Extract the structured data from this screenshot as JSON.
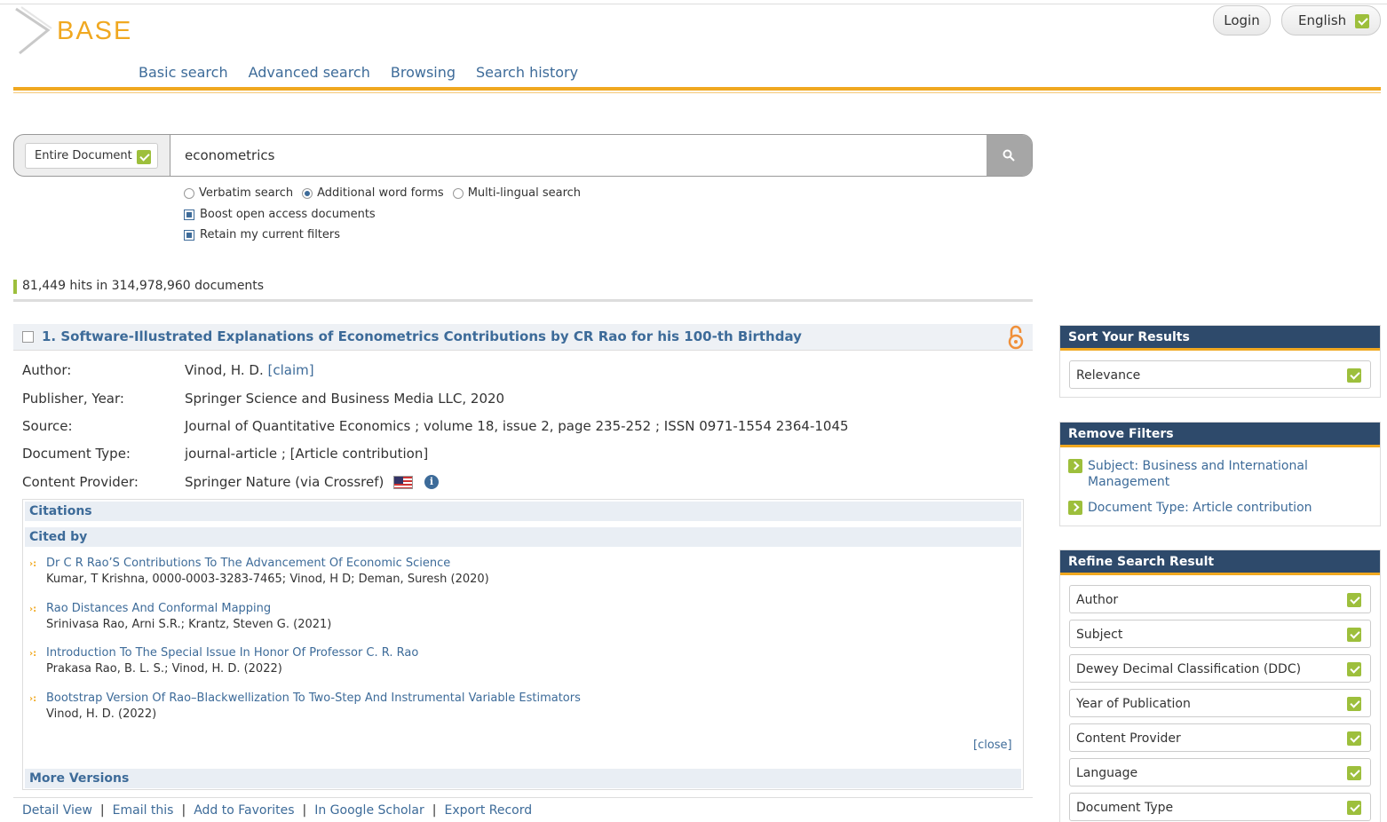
{
  "brand": {
    "logo_text": "BASE"
  },
  "header": {
    "login_label": "Login",
    "language_label": "English"
  },
  "nav": {
    "items": [
      "Basic search",
      "Advanced search",
      "Browsing",
      "Search history"
    ]
  },
  "search": {
    "scope": "Entire Document",
    "query": "econometrics",
    "options": {
      "verbatim": "Verbatim search",
      "additional": "Additional word forms",
      "multilingual": "Multi-lingual search",
      "selected": "Additional word forms"
    },
    "boost_open_access": {
      "label": "Boost open access documents",
      "checked": true
    },
    "retain_filters": {
      "label": "Retain my current filters",
      "checked": true
    }
  },
  "results_summary": "81,449 hits in 314,978,960 documents",
  "result": {
    "title": "1. Software-Illustrated Explanations of Econometrics Contributions by CR Rao for his 100-th Birthday",
    "author_label": "Author:",
    "author": "Vinod, H. D.",
    "claim": "[claim]",
    "publisher_label": "Publisher, Year:",
    "publisher": "Springer Science and Business Media LLC, 2020",
    "source_label": "Source:",
    "source": "Journal of Quantitative Economics ; volume 18, issue 2, page 235-252 ; ISSN 0971-1554 2364-1045",
    "doctype_label": "Document Type:",
    "doctype": "journal-article ; [Article contribution]",
    "provider_label": "Content Provider:",
    "provider": "Springer Nature (via Crossref)",
    "citations_label": "Citations",
    "cited_by_label": "Cited by",
    "cited_by": [
      {
        "title": "Dr C R Rao’S Contributions To The Advancement Of Economic Science",
        "authors": "Kumar, T Krishna, 0000-0003-3283-7465; Vinod, H D; Deman, Suresh (2020)"
      },
      {
        "title": "Rao Distances And Conformal Mapping",
        "authors": "Srinivasa Rao, Arni S.R.; Krantz, Steven G. (2021)"
      },
      {
        "title": "Introduction To The Special Issue In Honor Of Professor C. R. Rao",
        "authors": "Prakasa Rao, B. L. S.; Vinod, H. D. (2022)"
      },
      {
        "title": "Bootstrap Version Of Rao–Blackwellization To Two-Step And Instrumental Variable Estimators",
        "authors": "Vinod, H. D. (2022)"
      }
    ],
    "close_label": "[close]",
    "more_versions_label": "More Versions",
    "actions": [
      "Detail View",
      "Email this",
      "Add to Favorites",
      "In Google Scholar",
      "Export Record"
    ]
  },
  "sidebar": {
    "sort_title": "Sort Your Results",
    "sort_value": "Relevance",
    "remove_title": "Remove Filters",
    "filters": [
      "Subject: Business and International Management",
      "Document Type: Article contribution"
    ],
    "refine_title": "Refine Search Result",
    "refine": [
      "Author",
      "Subject",
      "Dewey Decimal Classification (DDC)",
      "Year of Publication",
      "Content Provider",
      "Language",
      "Document Type"
    ]
  },
  "colors": {
    "accent": "#f0a820",
    "link": "#3d6b99",
    "panel_header": "#2e4a6b",
    "check_green": "#9dbf3c"
  }
}
